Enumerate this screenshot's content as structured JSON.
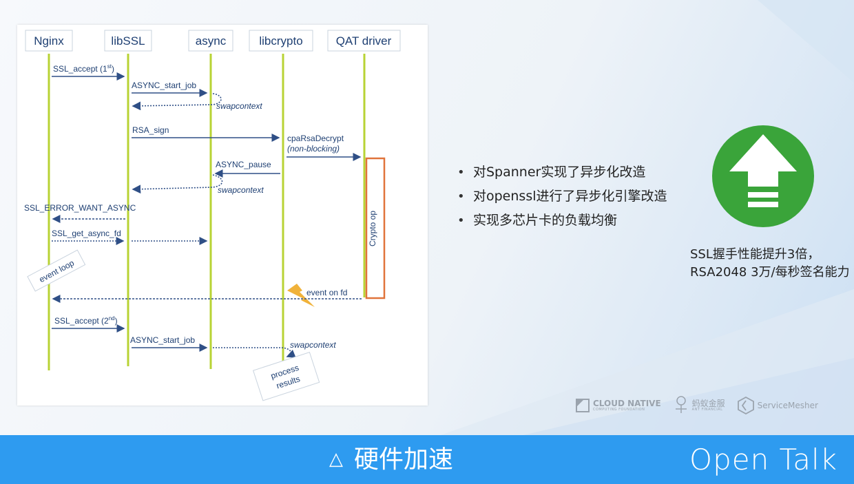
{
  "diagram": {
    "lifelines": [
      "Nginx",
      "libSSL",
      "async",
      "libcrypto",
      "QAT driver"
    ],
    "messages": {
      "ssl_accept_1": "SSL_accept (1",
      "ssl_accept_1_sup": "st",
      "ssl_accept_1_close": ")",
      "async_start_job_1": "ASYNC_start_job",
      "swapcontext_1": "swapcontext",
      "rsa_sign": "RSA_sign",
      "cpa_rsa_decrypt": "cpaRsaDecrypt",
      "non_blocking": "(non-blocking)",
      "async_pause": "ASYNC_pause",
      "swapcontext_2": "swapcontext",
      "ssl_error_want_async": "SSL_ERROR_WANT_ASYNC",
      "ssl_get_async_fd": "SSL_get_async_fd",
      "event_loop": "event loop",
      "event_on_fd": "event on fd",
      "crypto_op": "Crypto op",
      "ssl_accept_2": "SSL_accept (2",
      "ssl_accept_2_sup": "nd",
      "ssl_accept_2_close": ")",
      "async_start_job_2": "ASYNC_start_job",
      "swapcontext_3": "swapcontext",
      "process_results_1": "process",
      "process_results_2": "results"
    }
  },
  "bullets": [
    "对Spanner实现了异步化改造",
    "对openssl进行了异步化引擎改造",
    "实现多芯片卡的负载均衡"
  ],
  "bullet_symbol": "•",
  "caption": "SSL握手性能提升3倍，RSA2048 3万/每秒签名能力",
  "logos": {
    "cncf": "CLOUD NATIVE",
    "cncf_sub": "COMPUTING FOUNDATION",
    "ant": "蚂蚁金服",
    "ant_sub": "ANT FINANCIAL",
    "servicemesher": "ServiceMesher"
  },
  "footer": {
    "title": "硬件加速",
    "title_icon": "△",
    "brand": "Open Talk"
  },
  "colors": {
    "lifeline": "#b8d334",
    "arrow": "#2f4f86",
    "crypto_box": "#e0733a",
    "badge": "#3aa43a",
    "bar": "#2e9bf0",
    "lightning": "#f0b23a"
  }
}
